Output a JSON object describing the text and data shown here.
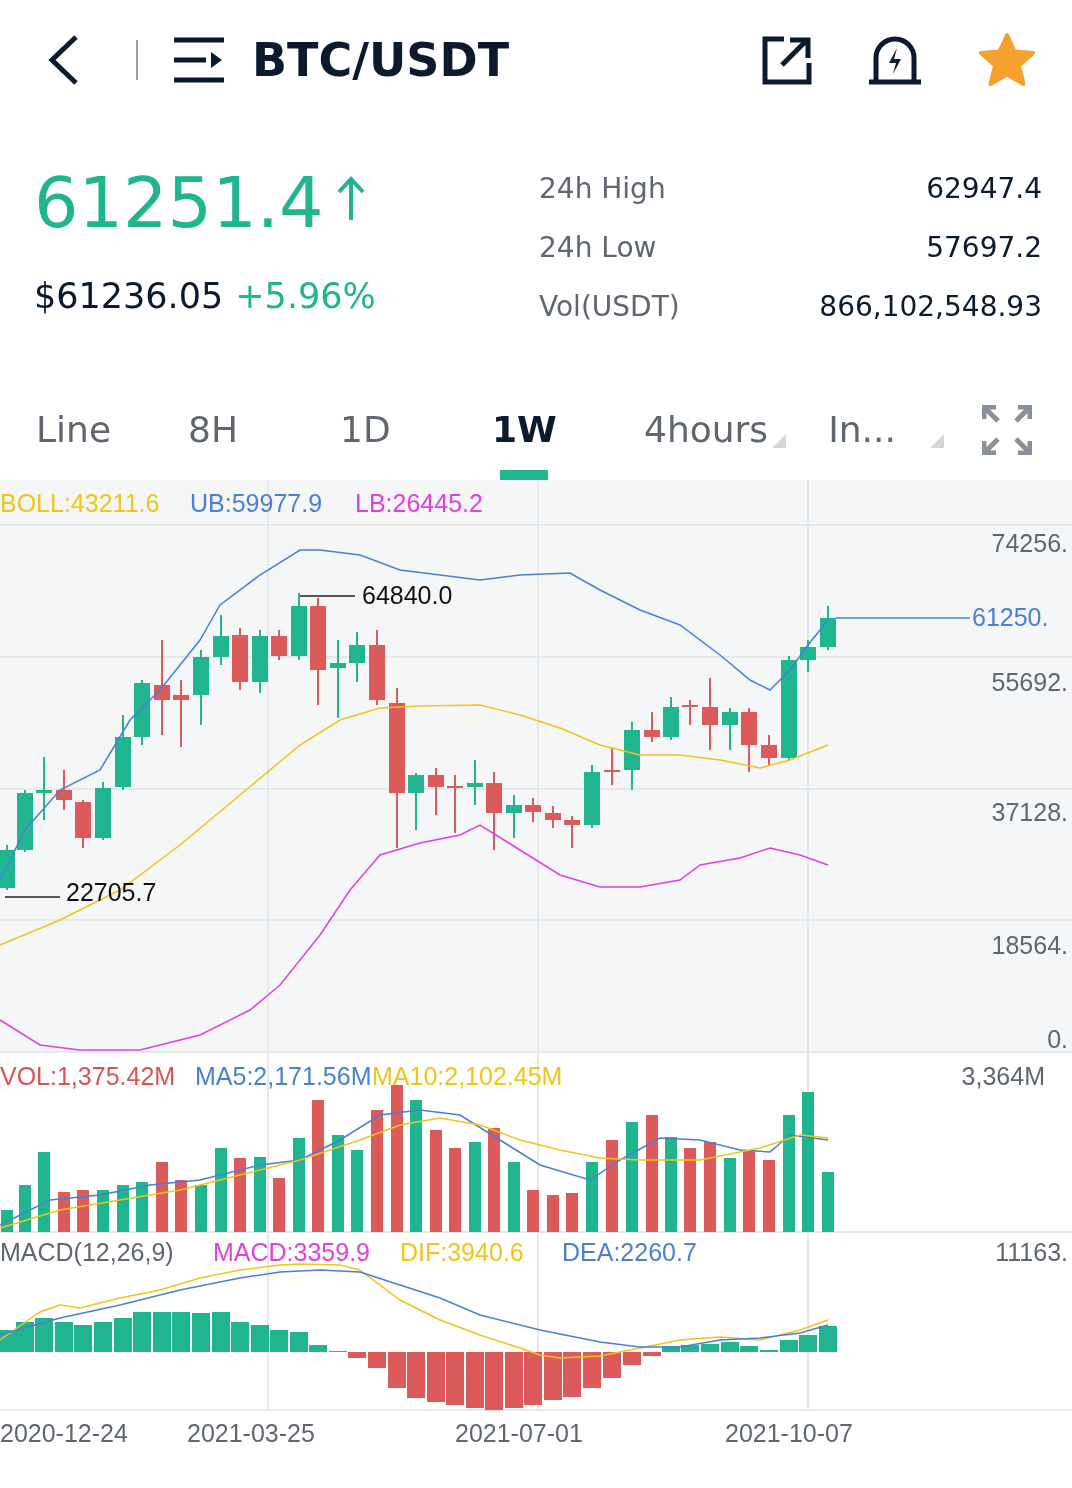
{
  "header": {
    "title": "BTC/USDT",
    "favorite": true
  },
  "ticker": {
    "price": "61251.4",
    "usd_price": "$61236.05",
    "change": "+5.96%",
    "stats": [
      {
        "label": "24h High",
        "value": "62947.4"
      },
      {
        "label": "24h Low",
        "value": "57697.2"
      },
      {
        "label": "Vol(USDT)",
        "value": "866,102,548.93"
      }
    ]
  },
  "tabs": [
    {
      "label": "Line",
      "kind": "plain",
      "selected": false
    },
    {
      "label": "8H",
      "kind": "plain",
      "selected": false
    },
    {
      "label": "1D",
      "kind": "plain",
      "selected": false
    },
    {
      "label": "1W",
      "kind": "plain",
      "selected": true
    },
    {
      "label": "4hours",
      "kind": "dropdown",
      "selected": false
    },
    {
      "label": "In...",
      "kind": "dropdown",
      "selected": false
    }
  ],
  "chart": {
    "boll_legend": [
      {
        "text": "BOLL:43211.6",
        "color": "#f0c419"
      },
      {
        "text": "UB:59977.9",
        "color": "#4a7fd6"
      },
      {
        "text": "LB:26445.2",
        "color": "#e040e0"
      }
    ],
    "price_ticks": [
      "74256.",
      "55692.",
      "37128.",
      "18564.",
      "0."
    ],
    "last_price": "61250.",
    "high_label": "64840.0",
    "low_label": "22705.7",
    "volume_legend": [
      {
        "text": "VOL:1,375.42M",
        "color": "#d9534f"
      },
      {
        "text": "MA5:2,171.56M",
        "color": "#4a7fd6"
      },
      {
        "text": "MA10:2,102.45M",
        "color": "#f0c419"
      }
    ],
    "volume_tick": "3,364M",
    "macd_legend": [
      {
        "text": "MACD(12,26,9)",
        "color": "#5f6670"
      },
      {
        "text": "MACD:3359.9",
        "color": "#e040e0"
      },
      {
        "text": "DIF:3940.6",
        "color": "#f0c419"
      },
      {
        "text": "DEA:2260.7",
        "color": "#4a7fd6"
      }
    ],
    "macd_tick": "11163.",
    "dates": [
      "2020-12-24",
      "2021-03-25",
      "2021-07-01",
      "2021-10-07"
    ]
  }
}
